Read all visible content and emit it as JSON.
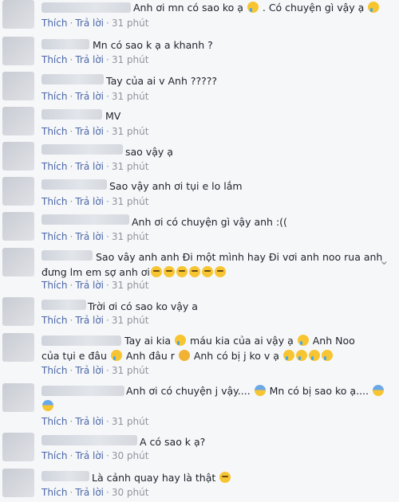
{
  "actions": {
    "like": "Thích",
    "reply": "Trả lời",
    "sep": "·"
  },
  "comments": [
    {
      "text": "Anh ơi mn có sao ko ạ",
      "text2": ". Có chuyện gì vậy ạ",
      "time": "31 phút"
    },
    {
      "text": "Mn có sao k ạ a khanh ?",
      "time": "31 phút"
    },
    {
      "text": "Tay của ai v Anh ?????",
      "time": "31 phút"
    },
    {
      "text": "MV",
      "time": "31 phút"
    },
    {
      "text": "sao vậy ạ",
      "time": "31 phút"
    },
    {
      "text": "Sao vậy anh ơi tụi e lo lắm",
      "time": "31 phút"
    },
    {
      "text": "Anh ơi có chuyện gì vậy anh :((",
      "time": "31 phút"
    },
    {
      "text": "Sao vây anh anh Đi một mình hay Đi vơi anh noo rua anh",
      "text2": "đưng lm em sợ anh ơi",
      "time": "31 phút"
    },
    {
      "text": "Trời ơi có sao ko vậy a",
      "time": "31 phút"
    },
    {
      "text": "Tay ai kia",
      "text2": "máu kia của ai vậy ạ",
      "text3": "Anh Noo",
      "line2a": "của tụi e đâu",
      "line2b": "Anh đâu r",
      "line2c": "Anh có bị j ko v ạ",
      "time": "31 phút"
    },
    {
      "text": "Anh ơi có chuyện j vậy....",
      "text2": "Mn có bị sao ko ạ....",
      "time": "31 phút"
    },
    {
      "text": "A có sao k ạ?",
      "time": "30 phút"
    },
    {
      "text": "Là cảnh quay hay là thật",
      "time": "30 phút"
    }
  ]
}
